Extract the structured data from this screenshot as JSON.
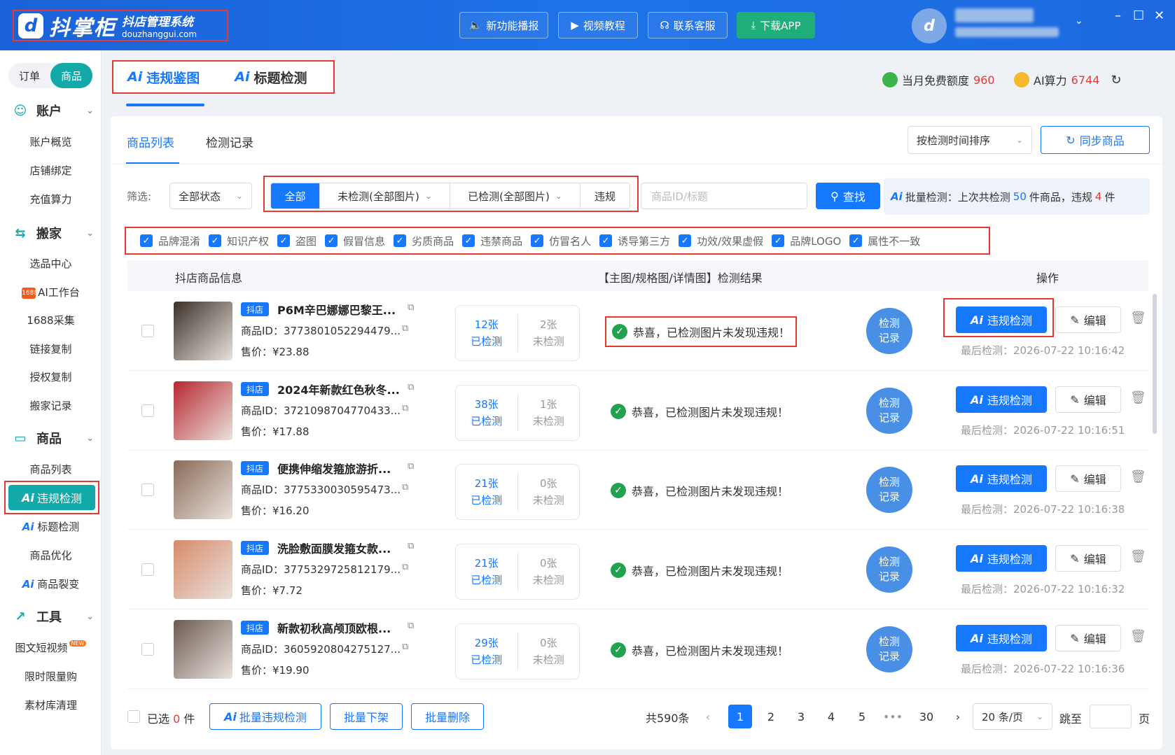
{
  "app": {
    "logo_mark": "d",
    "name": "抖掌柜",
    "subtitle": "抖店管理系统",
    "domain": "douzhanggui.com"
  },
  "topbar": {
    "buttons": [
      {
        "icon": "speaker-icon",
        "glyph": "🔈",
        "label": "新功能播报"
      },
      {
        "icon": "video-icon",
        "glyph": "▶",
        "label": "视频教程"
      },
      {
        "icon": "headset-icon",
        "glyph": "☊",
        "label": "联系客服"
      },
      {
        "icon": "download-icon",
        "glyph": "⤓",
        "label": "下载APP"
      }
    ],
    "avatar_glyph": "d"
  },
  "sidebar": {
    "segment": [
      "订单",
      "商品"
    ],
    "groups": [
      {
        "label": "账户",
        "items": [
          "账户概览",
          "店铺绑定",
          "充值算力"
        ]
      },
      {
        "label": "搬家",
        "items": [
          "选品中心",
          "AI工作台",
          "1688采集",
          "链接复制",
          "授权复制",
          "搬家记录"
        ]
      },
      {
        "label": "商品",
        "items": [
          "商品列表",
          "违规检测",
          "标题检测",
          "商品优化",
          "商品裂变"
        ]
      },
      {
        "label": "工具",
        "items": [
          "图文短视频",
          "限时限量购",
          "素材库清理"
        ]
      }
    ],
    "ai_prefix": "Ai",
    "badge_1688": "1688",
    "new_tag": "NEW"
  },
  "main_tabs": [
    "违规鉴图",
    "标题检测"
  ],
  "quota": {
    "free_label": "当月免费额度",
    "free_value": "960",
    "ai_label": "AI算力",
    "ai_value": "6744"
  },
  "panel_tabs": [
    "商品列表",
    "检测记录"
  ],
  "sort_select": "按检测时间排序",
  "sync_button": "同步商品",
  "filter": {
    "label": "筛选:",
    "status": "全部状态",
    "segments": [
      "全部",
      "未检测(全部图片)",
      "已检测(全部图片)",
      "违规"
    ],
    "search_placeholder": "商品ID/标题",
    "search_button": "查找"
  },
  "batch_info": {
    "prefix": "批量检测：上次共检测",
    "count": "50",
    "mid": "件商品，违规",
    "violations": "4",
    "suffix": "件"
  },
  "categories": [
    "品牌混淆",
    "知识产权",
    "盗图",
    "假冒信息",
    "劣质商品",
    "违禁商品",
    "仿冒名人",
    "诱导第三方",
    "功效/效果虚假",
    "品牌LOGO",
    "属性不一致"
  ],
  "table_headers": [
    "抖店商品信息",
    "【主图/规格图/详情图】检测结果",
    "操作"
  ],
  "labels": {
    "shop_tag": "抖店",
    "checked": "已检测",
    "unchecked": "未检测",
    "record_line1": "检测",
    "record_line2": "记录",
    "violate_btn": "违规检测",
    "edit_btn": "编辑",
    "result_ok": "恭喜，已检测图片未发现违规！"
  },
  "rows": [
    {
      "title": "P6M辛巴娜娜巴黎王...",
      "pid": "商品ID：3773801052294479...",
      "price": "售价：¥23.88",
      "checked": "12张",
      "unchecked": "2张",
      "last": "最后检测：2026-07-22 10:16:42",
      "thumb": "#3b3129"
    },
    {
      "title": "2024年新款红色秋冬...",
      "pid": "商品ID：3721098704770433...",
      "price": "售价：¥17.88",
      "checked": "38张",
      "unchecked": "1张",
      "last": "最后检测：2026-07-22 10:16:51",
      "thumb": "#b8262f"
    },
    {
      "title": "便携伸缩发箍旅游折...",
      "pid": "商品ID：3775330030595473...",
      "price": "售价：¥16.20",
      "checked": "21张",
      "unchecked": "0张",
      "last": "最后检测：2026-07-22 10:16:38",
      "thumb": "#8a6a58"
    },
    {
      "title": "洗脸敷面膜发箍女款...",
      "pid": "商品ID：3775329725812179...",
      "price": "售价：¥7.72",
      "checked": "21张",
      "unchecked": "0张",
      "last": "最后检测：2026-07-22 10:16:32",
      "thumb": "#d88a6a"
    },
    {
      "title": "新款初秋高颅顶欧根...",
      "pid": "商品ID：3605920804275127...",
      "price": "售价：¥19.90",
      "checked": "29张",
      "unchecked": "0张",
      "last": "最后检测：2026-07-22 10:16:36",
      "thumb": "#6b5a52"
    }
  ],
  "footer": {
    "selected_prefix": "已选",
    "selected_count": "0",
    "selected_suffix": "件",
    "batch_violate": "批量违规检测",
    "batch_off": "批量下架",
    "batch_delete": "批量删除",
    "total": "共590条",
    "pages": [
      "1",
      "2",
      "3",
      "4",
      "5",
      "•••",
      "30"
    ],
    "page_size": "20 条/页",
    "jump_label": "跳至",
    "page_unit": "页"
  },
  "colors": {
    "primary": "#1677ff",
    "teal": "#12a9a8",
    "alert": "#e53935",
    "success": "#22a24f"
  }
}
